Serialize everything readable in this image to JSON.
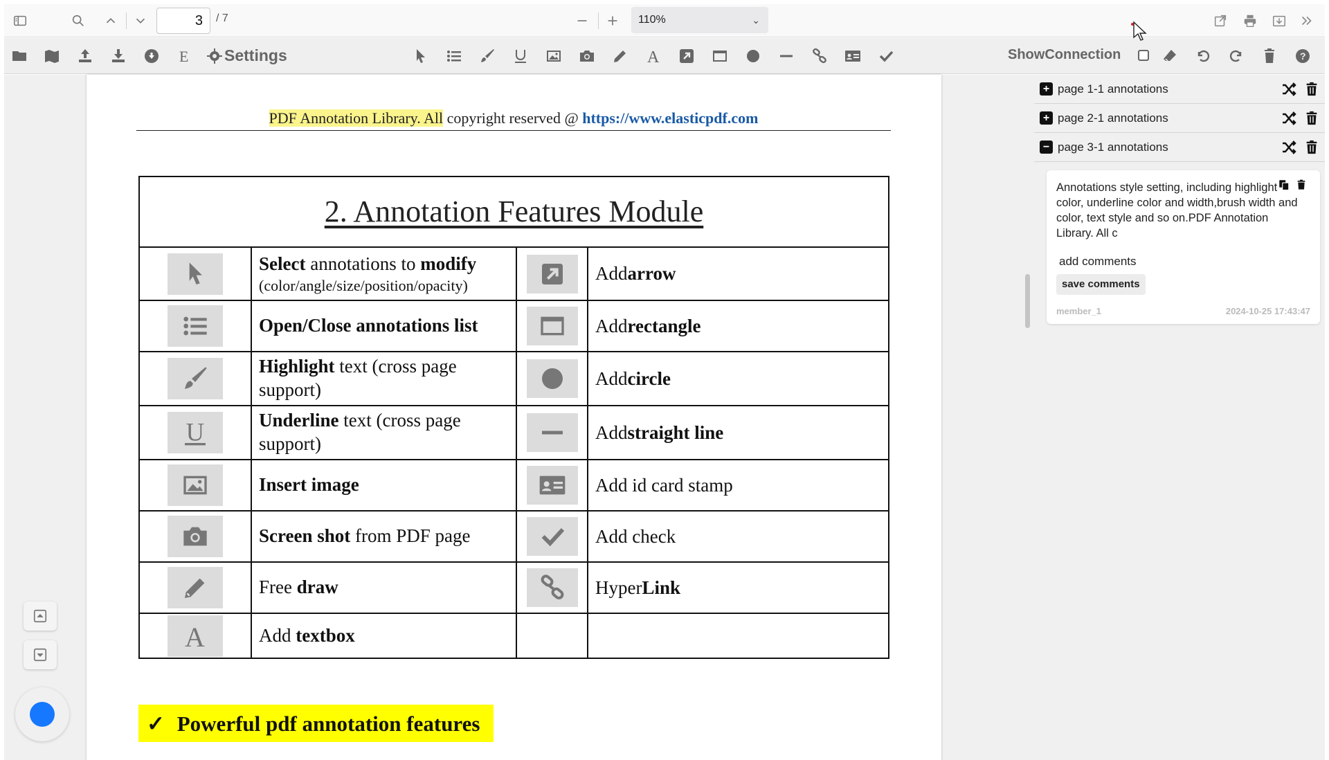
{
  "topbar": {
    "current_page": "3",
    "total_pages": "/ 7",
    "zoom": "110%"
  },
  "toolbar2": {
    "settings_label": "Settings",
    "show_connection_label": "ShowConnection",
    "show_connection_checked": false
  },
  "page": {
    "header_highlighted": "PDF Annotation Library. All",
    "header_plain": " copyright reserved @ ",
    "header_link": "https://www.elasticpdf.com",
    "table_title": "2. Annotation Features Module",
    "rows": [
      {
        "left_icon": "select-pointer-icon",
        "left_html_parts": [
          "Select",
          " annotations to ",
          "modify"
        ],
        "left_sub": "(color/angle/size/position/opacity)",
        "right_icon": "arrow-box-icon",
        "right_parts": [
          "Add ",
          "arrow"
        ]
      },
      {
        "left_icon": "list-icon",
        "left_parts": [
          "Open/Close annotations list"
        ],
        "right_icon": "rectangle-icon",
        "right_parts": [
          "Add ",
          "rectangle"
        ]
      },
      {
        "left_icon": "brush-icon",
        "left_parts": [
          "Highlight",
          " text (cross page support)"
        ],
        "right_icon": "circle-icon",
        "right_parts": [
          "Add ",
          "circle"
        ]
      },
      {
        "left_icon": "underline-icon",
        "left_parts": [
          "Underline",
          " text (cross page support)"
        ],
        "right_icon": "line-icon",
        "right_parts": [
          "Add ",
          "straight line"
        ]
      },
      {
        "left_icon": "image-icon",
        "left_parts": [
          "Insert image"
        ],
        "right_icon": "id-card-icon",
        "right_parts": [
          "Add id card stamp",
          ""
        ]
      },
      {
        "left_icon": "camera-icon",
        "left_parts": [
          "Screen shot",
          " from PDF page"
        ],
        "right_icon": "check-icon",
        "right_parts": [
          "Add check",
          ""
        ]
      },
      {
        "left_icon": "pencil-icon",
        "left_parts": [
          "Free ",
          "draw"
        ],
        "right_icon": "link-icon",
        "right_parts": [
          "Hyper ",
          "Link"
        ]
      },
      {
        "left_icon": "textbox-icon",
        "left_parts": [
          "Add ",
          "textbox"
        ],
        "right_icon": "",
        "right_parts": [
          "",
          ""
        ]
      }
    ],
    "powerful_check": "✓",
    "powerful_text": "Powerful pdf annotation features"
  },
  "sidebar": {
    "groups": [
      {
        "expand_symbol": "+",
        "label": "page 1-1 annotations"
      },
      {
        "expand_symbol": "+",
        "label": "page 2-1 annotations"
      },
      {
        "expand_symbol": "−",
        "label": "page 3-1 annotations"
      }
    ],
    "comment": {
      "body": "Annotations style setting, including highlight color, underline color and width,brush width and color, text style and so on.PDF Annotation Library. All c",
      "add_comments_placeholder": "add comments",
      "save_label": "save comments",
      "member": "member_1",
      "timestamp": "2024-10-25 17:43:47"
    }
  },
  "colors": {
    "highlight_yellow": "#fbf48c",
    "banner_yellow": "#ffff00",
    "link_blue": "#1a5aa6",
    "accent_blue": "#1677ff"
  }
}
